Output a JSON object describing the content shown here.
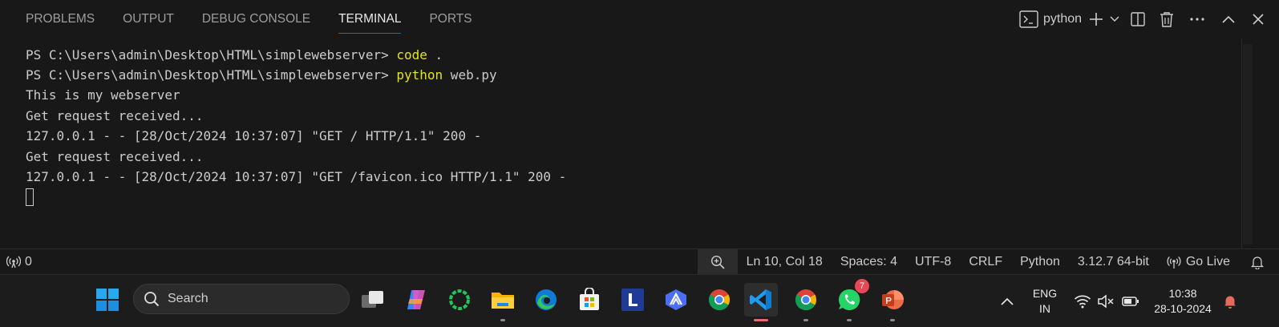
{
  "panel": {
    "tabs": [
      {
        "label": "PROBLEMS",
        "active": false
      },
      {
        "label": "OUTPUT",
        "active": false
      },
      {
        "label": "DEBUG CONSOLE",
        "active": false
      },
      {
        "label": "TERMINAL",
        "active": true
      },
      {
        "label": "PORTS",
        "active": false
      }
    ],
    "terminal_name": "python"
  },
  "terminal": {
    "lines": [
      {
        "prompt": "PS C:\\Users\\admin\\Desktop\\HTML\\simplewebserver> ",
        "cmd": "code",
        "rest": " ."
      },
      {
        "prompt": "PS C:\\Users\\admin\\Desktop\\HTML\\simplewebserver> ",
        "cmd": "python",
        "rest": " web.py"
      },
      {
        "text": "This is my webserver"
      },
      {
        "text": "Get request received..."
      },
      {
        "text": "127.0.0.1 - - [28/Oct/2024 10:37:07] \"GET / HTTP/1.1\" 200 -"
      },
      {
        "text": "Get request received..."
      },
      {
        "text": "127.0.0.1 - - [28/Oct/2024 10:37:07] \"GET /favicon.ico HTTP/1.1\" 200 -"
      }
    ],
    "command_color": "#e5e510"
  },
  "statusbar": {
    "ports_count": "0",
    "position": "Ln 10, Col 18",
    "spaces": "Spaces: 4",
    "encoding": "UTF-8",
    "eol": "CRLF",
    "language": "Python",
    "interpreter": "3.12.7 64-bit",
    "go_live": "Go Live"
  },
  "taskbar": {
    "search_label": "Search",
    "apps": [
      "task-view",
      "copilot",
      "app-green-ring",
      "file-explorer",
      "edge",
      "microsoft-store",
      "l-app",
      "arc-app",
      "chrome",
      "vscode",
      "chrome-profile",
      "whatsapp",
      "powerpoint"
    ],
    "whatsapp_badge": "7",
    "language_line1": "ENG",
    "language_line2": "IN",
    "time": "10:38",
    "date": "28-10-2024"
  },
  "colors": {
    "accent": "#0078d4",
    "background": "#181818"
  }
}
